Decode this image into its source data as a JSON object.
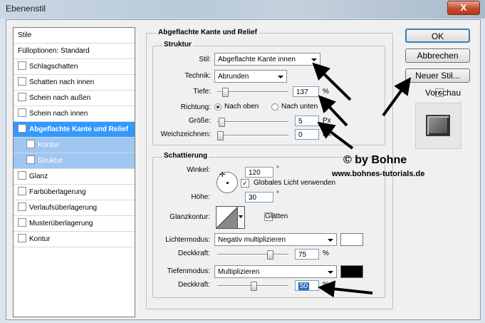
{
  "window": {
    "title": "Ebenenstil",
    "close_glyph": "X"
  },
  "styles_list": [
    {
      "label": "Stile",
      "checkbox": false,
      "state": "header"
    },
    {
      "label": "Fülloptionen: Standard",
      "checkbox": false,
      "state": "header"
    },
    {
      "label": "Schlagschatten",
      "checkbox": true,
      "checked": false,
      "state": "normal"
    },
    {
      "label": "Schatten nach innen",
      "checkbox": true,
      "checked": false,
      "state": "normal"
    },
    {
      "label": "Schein nach außen",
      "checkbox": true,
      "checked": false,
      "state": "normal"
    },
    {
      "label": "Schein nach innen",
      "checkbox": true,
      "checked": false,
      "state": "normal"
    },
    {
      "label": "Abgeflachte Kante und Relief",
      "checkbox": true,
      "checked": true,
      "state": "selected"
    },
    {
      "label": "Kontur",
      "checkbox": true,
      "checked": false,
      "state": "sub"
    },
    {
      "label": "Struktur",
      "checkbox": true,
      "checked": false,
      "state": "sub"
    },
    {
      "label": "Glanz",
      "checkbox": true,
      "checked": false,
      "state": "normal"
    },
    {
      "label": "Farbüberlagerung",
      "checkbox": true,
      "checked": false,
      "state": "normal"
    },
    {
      "label": "Verlaufsüberlagerung",
      "checkbox": true,
      "checked": false,
      "state": "normal"
    },
    {
      "label": "Musterüberlagerung",
      "checkbox": true,
      "checked": false,
      "state": "normal"
    },
    {
      "label": "Kontur",
      "checkbox": true,
      "checked": false,
      "state": "normal"
    }
  ],
  "section_title": "Abgeflachte Kante und Relief",
  "struktur": {
    "title": "Struktur",
    "stil_label": "Stil:",
    "stil_value": "Abgeflachte Kante innen",
    "technik_label": "Technik:",
    "technik_value": "Abrunden",
    "tiefe_label": "Tiefe:",
    "tiefe_value": "137",
    "tiefe_unit": "%",
    "tiefe_slider_fraction": 0.08,
    "richtung_label": "Richtung:",
    "nach_oben": "Nach oben",
    "nach_unten": "Nach unten",
    "richtung_selected": "Nach oben",
    "groesse_label": "Größe:",
    "groesse_value": "5",
    "groesse_unit": "Px",
    "groesse_slider_fraction": 0.02,
    "weich_label": "Weichzeichnen:",
    "weich_value": "0",
    "weich_unit": "Px",
    "weich_slider_fraction": 0.0
  },
  "schattierung": {
    "title": "Schattierung",
    "winkel_label": "Winkel:",
    "winkel_value": "120",
    "winkel_unit": "°",
    "global_light_label": "Globales Licht verwenden",
    "global_light_checked": true,
    "hoehe_label": "Höhe:",
    "hoehe_value": "30",
    "hoehe_unit": "°",
    "glanzkontur_label": "Glanzkontur:",
    "glaetten_label": "Glätten",
    "glaetten_checked": false,
    "lichtermodus_label": "Lichtermodus:",
    "lichtermodus_value": "Negativ multiplizieren",
    "lichter_color": "#ffffff",
    "deckkraft1_label": "Deckkraft:",
    "deckkraft1_value": "75",
    "deckkraft1_unit": "%",
    "deckkraft1_fraction": 0.75,
    "tiefenmodus_label": "Tiefenmodus:",
    "tiefenmodus_value": "Multiplizieren",
    "tiefen_color": "#000000",
    "deckkraft2_label": "Deckkraft:",
    "deckkraft2_value": "50",
    "deckkraft2_unit": "%",
    "deckkraft2_fraction": 0.5
  },
  "buttons": {
    "ok": "OK",
    "abbrechen": "Abbrechen",
    "neuer_stil": "Neuer Stil...",
    "vorschau_label": "Vorschau",
    "vorschau_checked": true
  },
  "watermark": {
    "line1": "© by Bohne",
    "line2": "www.bohnes-tutorials.de"
  },
  "colors": {
    "selection": "#3399ff",
    "sub_selection": "#9fc6f1",
    "arrow": "#000000"
  }
}
